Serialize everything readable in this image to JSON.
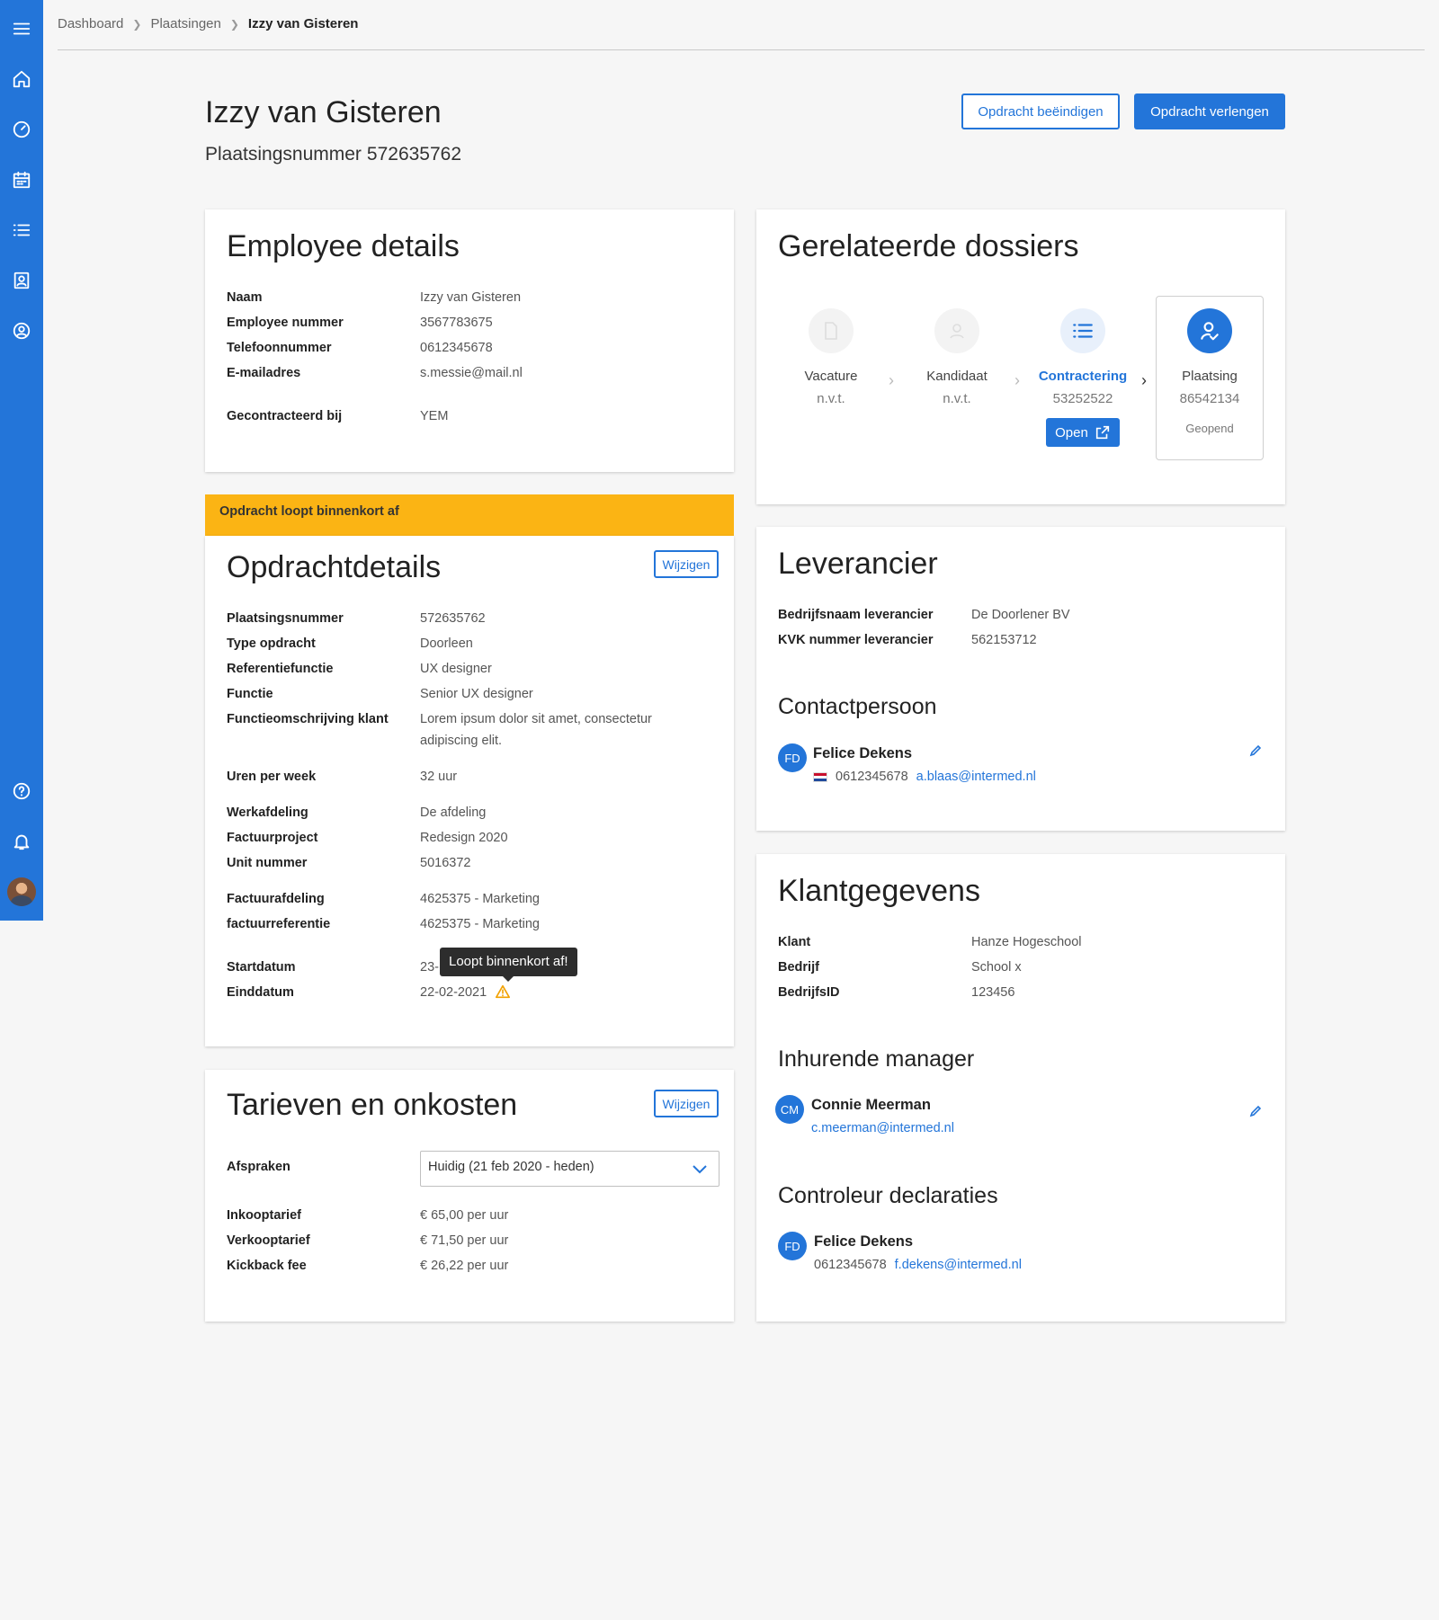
{
  "breadcrumb": {
    "items": [
      "Dashboard",
      "Plaatsingen"
    ],
    "current": "Izzy van Gisteren"
  },
  "header": {
    "title": "Izzy van Gisteren",
    "subtitle_label": "Plaatsingsnummer",
    "subtitle_value": "572635762",
    "btn_end": "Opdracht beëindigen",
    "btn_extend": "Opdracht verlengen"
  },
  "sidebar": {
    "icons": [
      "menu-icon",
      "home-icon",
      "dashboard-icon",
      "calendar-icon",
      "list-icon",
      "contacts-icon",
      "account-icon",
      "help-icon",
      "bell-icon"
    ]
  },
  "employee": {
    "title": "Employee details",
    "rows": [
      {
        "label": "Naam",
        "value": "Izzy van Gisteren"
      },
      {
        "label": "Employee nummer",
        "value": "3567783675"
      },
      {
        "label": "Telefoonnummer",
        "value": "0612345678"
      },
      {
        "label": "E-mailadres",
        "value": "s.messie@mail.nl"
      },
      {
        "label": "Gecontracteerd bij",
        "value": "YEM"
      }
    ]
  },
  "banner": {
    "text": "Opdracht loopt binnenkort af"
  },
  "opdracht": {
    "title": "Opdrachtdetails",
    "edit": "Wijzigen",
    "rows": [
      {
        "label": "Plaatsingsnummer",
        "value": "572635762"
      },
      {
        "label": "Type opdracht",
        "value": "Doorleen"
      },
      {
        "label": "Referentiefunctie",
        "value": "UX designer"
      },
      {
        "label": "Functie",
        "value": "Senior UX designer"
      },
      {
        "label": "Functieomschrijving klant",
        "value": "Lorem ipsum dolor sit amet, consectetur",
        "value2": "adipiscing elit."
      },
      {
        "label": "Uren per week",
        "value": "32 uur"
      },
      {
        "label": "Werkafdeling",
        "value": "De afdeling"
      },
      {
        "label": "Factuurproject",
        "value": "Redesign 2020"
      },
      {
        "label": "Unit nummer",
        "value": "5016372"
      },
      {
        "label": "Factuurafdeling",
        "value": "4625375 - Marketing"
      },
      {
        "label": "factuurreferentie",
        "value": "4625375 - Marketing"
      },
      {
        "label": "Startdatum",
        "value": "23-"
      },
      {
        "label": "Einddatum",
        "value": "22-02-2021"
      }
    ],
    "tooltip": "Loopt binnenkort af!"
  },
  "tarieven": {
    "title": "Tarieven en onkosten",
    "edit": "Wijzigen",
    "afspraken_label": "Afspraken",
    "afspraken_value": "Huidig (21 feb 2020 - heden)",
    "rows": [
      {
        "label": "Inkooptarief",
        "value": "€ 65,00 per uur"
      },
      {
        "label": "Verkooptarief",
        "value": "€ 71,50 per uur"
      },
      {
        "label": "Kickback fee",
        "value": "€ 26,22 per uur"
      }
    ]
  },
  "dossiers": {
    "title": "Gerelateerde dossiers",
    "steps": [
      {
        "name": "Vacature",
        "num": "n.v.t."
      },
      {
        "name": "Kandidaat",
        "num": "n.v.t."
      },
      {
        "name": "Contractering",
        "num": "53252522",
        "button": "Open"
      },
      {
        "name": "Plaatsing",
        "num": "86542134",
        "status": "Geopend"
      }
    ]
  },
  "leverancier": {
    "title": "Leverancier",
    "rows": [
      {
        "label": "Bedrijfsnaam leverancier",
        "value": "De Doorlener BV"
      },
      {
        "label": "KVK nummer leverancier",
        "value": "562153712"
      }
    ],
    "contact_title": "Contactpersoon",
    "contact": {
      "initials": "FD",
      "name": "Felice Dekens",
      "phone": "0612345678",
      "email": "a.blaas@intermed.nl"
    }
  },
  "klant": {
    "title": "Klantgegevens",
    "rows": [
      {
        "label": "Klant",
        "value": "Hanze Hogeschool"
      },
      {
        "label": "Bedrijf",
        "value": "School x"
      },
      {
        "label": "BedrijfsID",
        "value": "123456"
      }
    ],
    "manager_title": "Inhurende manager",
    "manager": {
      "initials": "CM",
      "name": "Connie Meerman",
      "email": "c.meerman@intermed.nl"
    },
    "controleur_title": "Controleur declaraties",
    "controleur": {
      "initials": "FD",
      "name": "Felice Dekens",
      "phone": "0612345678",
      "email": "f.dekens@intermed.nl"
    }
  },
  "colors": {
    "primary": "#2375d9",
    "warning": "#fbb414",
    "background": "#f6f6f6"
  }
}
